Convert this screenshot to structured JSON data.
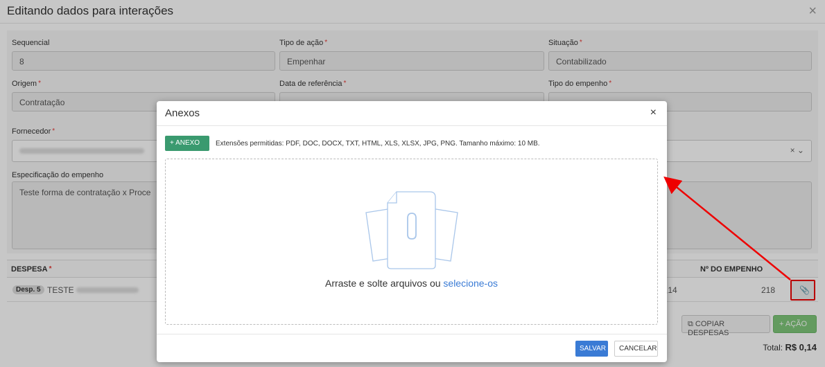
{
  "page": {
    "title": "Editando dados para interações",
    "close_icon": "close-icon"
  },
  "form": {
    "sequencial_label": "Sequencial",
    "sequencial_value": "8",
    "tipo_acao_label": "Tipo de ação",
    "tipo_acao_value": "Empenhar",
    "situacao_label": "Situação",
    "situacao_value": "Contabilizado",
    "origem_label": "Origem",
    "origem_value": "Contratação",
    "data_ref_label": "Data de referência",
    "tipo_empenho_label": "Tipo do empenho",
    "fornecedor_label": "Fornecedor",
    "especificacao_label": "Especificação do empenho",
    "especificacao_value": "Teste forma de contratação x Proce",
    "required_mark": "*"
  },
  "table": {
    "col_despesa": "DESPESA",
    "col_numero": "Nº DO EMPENHO",
    "row_badge": "Desp. 5",
    "row_text": "TESTE",
    "row_value_partial": ",14",
    "row_numero": "218"
  },
  "actions": {
    "copy_label": "COPIAR DESPESAS",
    "acao_label": "+ AÇÃO",
    "total_label": "Total:",
    "total_value": "R$ 0,14"
  },
  "modal": {
    "title": "Anexos",
    "anexo_button": "+ ANEXO",
    "extensions_text": "Extensões permitidas: PDF, DOC, DOCX, TXT, HTML, XLS, XLSX, JPG, PNG. Tamanho máximo: 10 MB.",
    "drop_text": "Arraste e solte arquivos ou ",
    "drop_link": "selecione-os",
    "save_label": "SALVAR",
    "cancel_label": "CANCELAR"
  },
  "colors": {
    "accent_green": "#3a9a6f",
    "accent_blue": "#3a7bd5",
    "highlight_red": "#e00000"
  }
}
